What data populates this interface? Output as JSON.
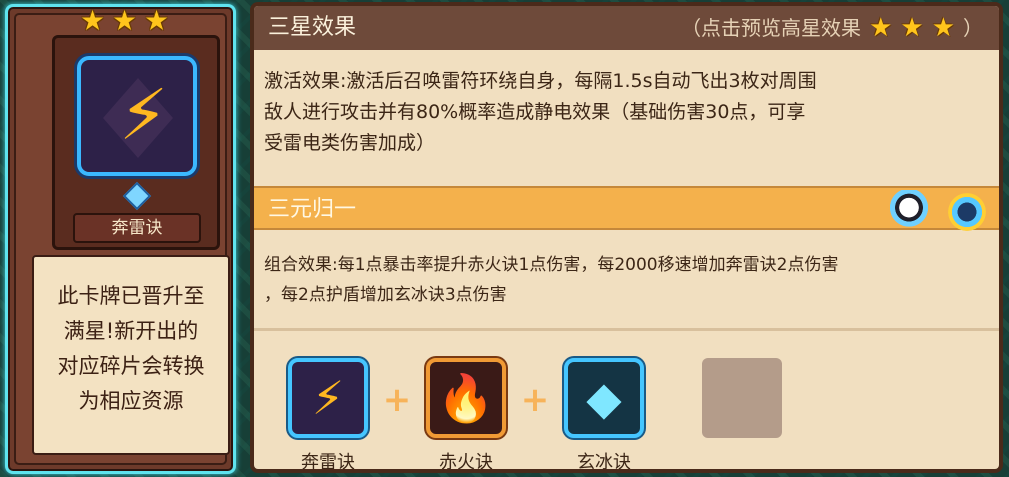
{
  "card": {
    "stars": [
      "★",
      "★",
      "★"
    ],
    "name": "奔雷诀",
    "description_lines": [
      "此卡牌已晋升至",
      "满星!新开出的",
      "对应碎片会转换",
      "为相应资源"
    ]
  },
  "panel": {
    "three_star_title": "三星效果",
    "preview_hint_prefix": "（点击预览高星效果",
    "preview_hint_suffix": "）",
    "preview_stars": [
      "★",
      "★",
      "★"
    ],
    "activation_lines": [
      "激活效果:激活后召唤雷符环绕自身，每隔1.5s自动飞出3枚对周围",
      "敌人进行攻击并有80%概率造成静电效果（基础伤害30点，可享",
      "受雷电类伤害加成）"
    ],
    "combo_title": "三元归一",
    "combo_lines": [
      "组合效果:每1点暴击率提升赤火诀1点伤害，每2000移速增加奔雷诀2点伤害",
      "，每2点护盾增加玄冰诀3点伤害"
    ],
    "combo_cards": [
      {
        "label": "奔雷诀",
        "icon": "lightning-icon"
      },
      {
        "label": "赤火诀",
        "icon": "fire-icon"
      },
      {
        "label": "玄冰诀",
        "icon": "ice-crystal-icon"
      }
    ],
    "plus": "+"
  }
}
